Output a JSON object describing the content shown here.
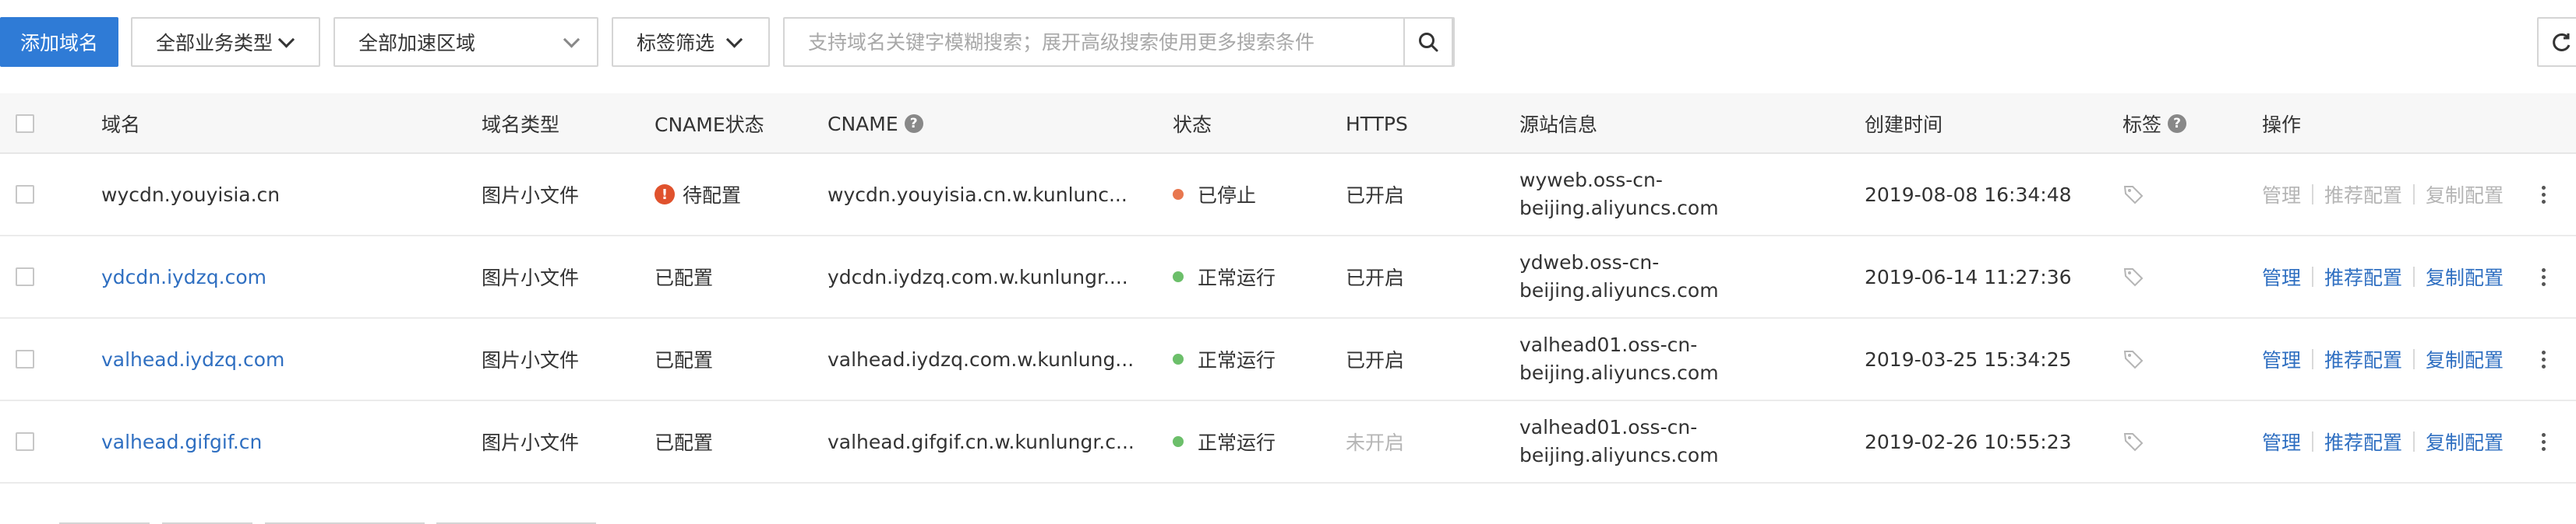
{
  "toolbar": {
    "add_domain_label": "添加域名",
    "business_type_select": "全部业务类型",
    "region_select": "全部加速区域",
    "tag_filter": "标签筛选",
    "search_placeholder": "支持域名关键字模糊搜索；展开高级搜索使用更多搜索条件",
    "search_icon": "search-icon",
    "refresh_icon": "refresh-icon"
  },
  "table": {
    "headers": {
      "domain": "域名",
      "type": "域名类型",
      "cname_status": "CNAME状态",
      "cname": "CNAME",
      "status": "状态",
      "https": "HTTPS",
      "origin": "源站信息",
      "created": "创建时间",
      "tags": "标签",
      "actions": "操作"
    },
    "rows": [
      {
        "domain": "wycdn.youyisia.cn",
        "type": "图片小文件",
        "cname_status": "待配置",
        "cname": "wycdn.youyisia.cn.w.kunlunc...",
        "status": "已停止",
        "status_color": "#e8774f",
        "https": "已开启",
        "origin_line1": "wyweb.oss-cn-",
        "origin_line2": "beijing.aliyuncs.com",
        "created": "2019-08-08 16:34:48",
        "manage": "管理",
        "recommend": "推荐配置",
        "copy": "复制配置"
      },
      {
        "domain": "ydcdn.iydzq.com",
        "type": "图片小文件",
        "cname_status": "已配置",
        "cname": "ydcdn.iydzq.com.w.kunlungr....",
        "status": "正常运行",
        "status_color": "#6cbf6a",
        "https": "已开启",
        "origin_line1": "ydweb.oss-cn-",
        "origin_line2": "beijing.aliyuncs.com",
        "created": "2019-06-14 11:27:36",
        "manage": "管理",
        "recommend": "推荐配置",
        "copy": "复制配置"
      },
      {
        "domain": "valhead.iydzq.com",
        "type": "图片小文件",
        "cname_status": "已配置",
        "cname": "valhead.iydzq.com.w.kunlung...",
        "status": "正常运行",
        "status_color": "#6cbf6a",
        "https": "已开启",
        "origin_line1": "valhead01.oss-cn-",
        "origin_line2": "beijing.aliyuncs.com",
        "created": "2019-03-25 15:34:25",
        "manage": "管理",
        "recommend": "推荐配置",
        "copy": "复制配置"
      },
      {
        "domain": "valhead.gifgif.cn",
        "type": "图片小文件",
        "cname_status": "已配置",
        "cname": "valhead.gifgif.cn.w.kunlungr.c...",
        "status": "正常运行",
        "status_color": "#6cbf6a",
        "https": "未开启",
        "origin_line1": "valhead01.oss-cn-",
        "origin_line2": "beijing.aliyuncs.com",
        "created": "2019-02-26 10:55:23",
        "manage": "管理",
        "recommend": "推荐配置",
        "copy": "复制配置"
      }
    ]
  },
  "colors": {
    "primary": "#2f7bd6",
    "link": "#2f6fc1",
    "warning": "#e0522d"
  }
}
